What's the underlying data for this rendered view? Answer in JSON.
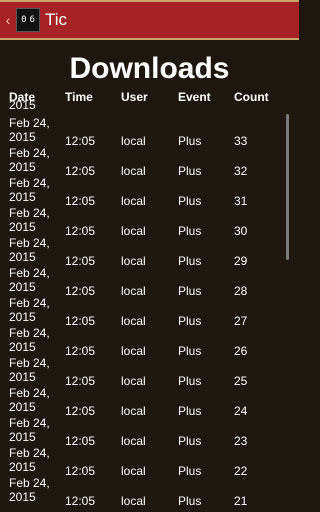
{
  "appbar": {
    "back_glyph": "‹",
    "icon_digits": [
      "0",
      "6"
    ],
    "title": "Tic"
  },
  "page": {
    "heading": "Downloads"
  },
  "table": {
    "headers": {
      "date": "Date",
      "time": "Time",
      "user": "User",
      "event": "Event",
      "count": "Count"
    },
    "partial_top_date": "2015",
    "rows": [
      {
        "date_line1": "Feb 24,",
        "date_line2": "2015",
        "time": "12:05",
        "user": "local",
        "event": "Plus",
        "count": "33"
      },
      {
        "date_line1": "Feb 24,",
        "date_line2": "2015",
        "time": "12:05",
        "user": "local",
        "event": "Plus",
        "count": "32"
      },
      {
        "date_line1": "Feb 24,",
        "date_line2": "2015",
        "time": "12:05",
        "user": "local",
        "event": "Plus",
        "count": "31"
      },
      {
        "date_line1": "Feb 24,",
        "date_line2": "2015",
        "time": "12:05",
        "user": "local",
        "event": "Plus",
        "count": "30"
      },
      {
        "date_line1": "Feb 24,",
        "date_line2": "2015",
        "time": "12:05",
        "user": "local",
        "event": "Plus",
        "count": "29"
      },
      {
        "date_line1": "Feb 24,",
        "date_line2": "2015",
        "time": "12:05",
        "user": "local",
        "event": "Plus",
        "count": "28"
      },
      {
        "date_line1": "Feb 24,",
        "date_line2": "2015",
        "time": "12:05",
        "user": "local",
        "event": "Plus",
        "count": "27"
      },
      {
        "date_line1": "Feb 24,",
        "date_line2": "2015",
        "time": "12:05",
        "user": "local",
        "event": "Plus",
        "count": "26"
      },
      {
        "date_line1": "Feb 24,",
        "date_line2": "2015",
        "time": "12:05",
        "user": "local",
        "event": "Plus",
        "count": "25"
      },
      {
        "date_line1": "Feb 24,",
        "date_line2": "2015",
        "time": "12:05",
        "user": "local",
        "event": "Plus",
        "count": "24"
      },
      {
        "date_line1": "Feb 24,",
        "date_line2": "2015",
        "time": "12:05",
        "user": "local",
        "event": "Plus",
        "count": "23"
      },
      {
        "date_line1": "Feb 24,",
        "date_line2": "2015",
        "time": "12:05",
        "user": "local",
        "event": "Plus",
        "count": "22"
      },
      {
        "date_line1": "Feb 24,",
        "date_line2": "2015",
        "time": "12:05",
        "user": "local",
        "event": "Plus",
        "count": "21"
      }
    ]
  },
  "colors": {
    "appbar": "#a52324",
    "appbar_border": "#c8a46a",
    "background": "#1d1710",
    "text": "#ffffff"
  }
}
